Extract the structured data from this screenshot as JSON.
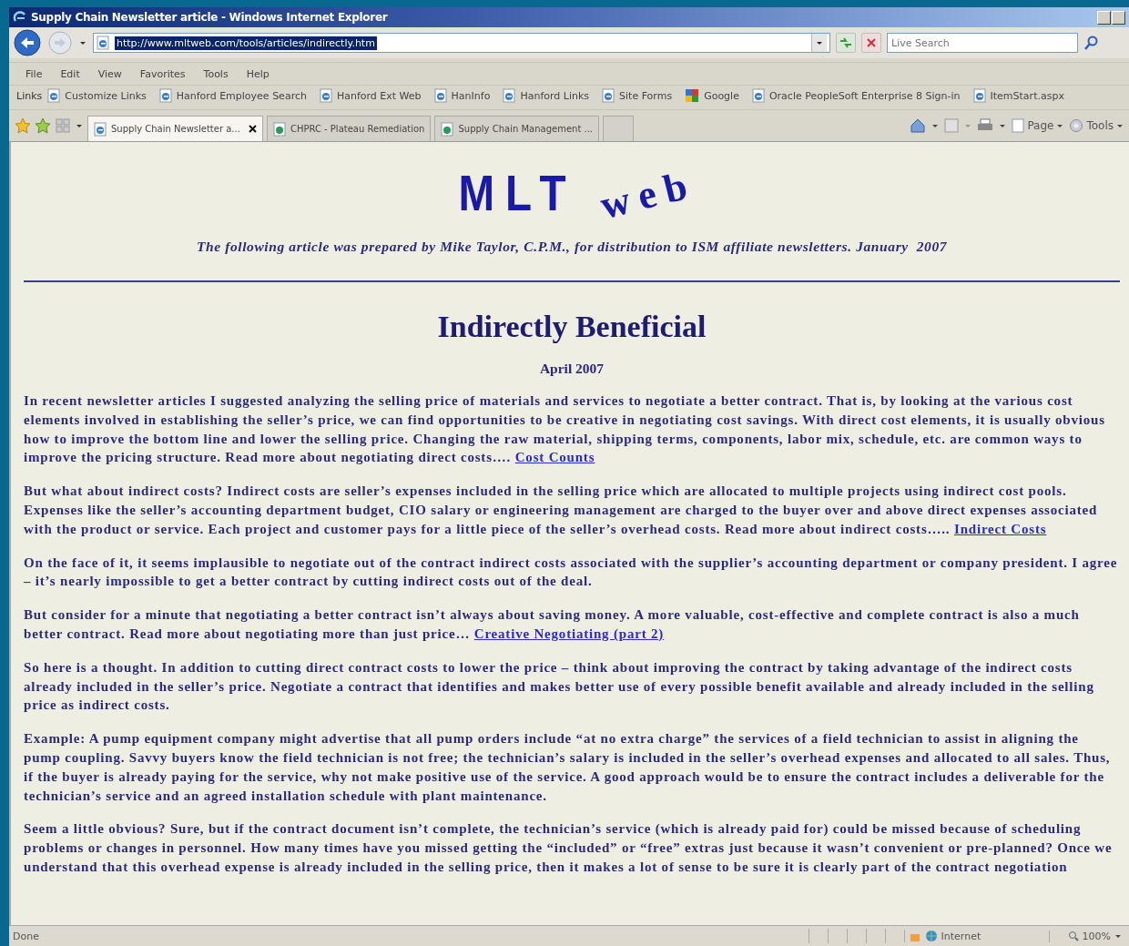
{
  "window": {
    "title": "Supply Chain Newsletter article - Windows Internet Explorer"
  },
  "address_bar": {
    "url": "http://www.mltweb.com/tools/articles/indirectly.htm",
    "url_selected": true
  },
  "search": {
    "placeholder": "Live Search"
  },
  "menu": [
    "File",
    "Edit",
    "View",
    "Favorites",
    "Tools",
    "Help"
  ],
  "links_bar": {
    "label": "Links",
    "items": [
      {
        "label": "Customize Links",
        "kind": "page"
      },
      {
        "label": "Hanford Employee Search",
        "kind": "page"
      },
      {
        "label": "Hanford Ext Web",
        "kind": "page"
      },
      {
        "label": "HanInfo",
        "kind": "page"
      },
      {
        "label": "Hanford Links",
        "kind": "page"
      },
      {
        "label": "Site Forms",
        "kind": "page"
      },
      {
        "label": "Google",
        "kind": "google"
      },
      {
        "label": "Oracle PeopleSoft Enterprise 8 Sign-in",
        "kind": "page"
      },
      {
        "label": "ItemStart.aspx",
        "kind": "page"
      }
    ]
  },
  "tabs": [
    {
      "label": "Supply Chain Newsletter a...",
      "selected": true
    },
    {
      "label": "CHPRC - Plateau Remediation",
      "selected": false
    },
    {
      "label": "Supply Chain Management ...",
      "selected": false
    }
  ],
  "command_bar": [
    "Page",
    "Tools"
  ],
  "page": {
    "logo": {
      "main": "MLT",
      "tail": "web"
    },
    "byline": "The following article was prepared by Mike Taylor, C.P.M., for distribution to ISM affiliate newsletters. January  2007",
    "title": "Indirectly Beneficial",
    "date": "April 2007",
    "paragraphs": [
      {
        "text": "In recent newsletter articles I suggested analyzing the selling price of materials and services to negotiate a better contract. That is, by looking at the various cost elements involved in establishing the seller’s price, we can find opportunities to be creative in negotiating cost savings. With direct cost elements, it is usually obvious how to improve the bottom line and lower the selling price. Changing the raw material, shipping terms, components, labor mix, schedule, etc. are common ways to improve the pricing structure. Read more about negotiating direct costs….",
        "link": "Cost Counts"
      },
      {
        "text": "But what about indirect costs? Indirect costs are seller’s expenses included in the selling price which are allocated to multiple projects using indirect cost pools. Expenses like the seller’s accounting department budget, CIO salary or engineering management are charged to the buyer over and above direct expenses associated with the product or service. Each project and customer pays for a little piece of the seller’s overhead costs. Read more about indirect costs…..",
        "link": "Indirect Costs"
      },
      {
        "text": "On the face of it, it seems implausible to negotiate out of the contract indirect costs associated with the supplier’s accounting department or company president. I agree – it’s nearly impossible to get a better contract by cutting indirect costs out of the deal."
      },
      {
        "text": "But consider for a minute that negotiating a better contract isn’t always about saving money. A more valuable, cost-effective and complete contract is also a much better contract. Read more about negotiating more than just price…",
        "link": "Creative Negotiating (part 2)"
      },
      {
        "text": "So here is a thought. In addition to cutting direct contract costs to lower the price – think about improving the contract by taking advantage of the indirect costs already included in the seller’s price. Negotiate a contract that identifies and makes better use of every possible benefit available and already included in the selling price as indirect costs."
      },
      {
        "text": "Example: A pump equipment company might advertise that all pump orders include “at no extra charge” the services of a field technician to assist in aligning the pump coupling. Savvy buyers know the field technician is not free; the technician’s salary is included in the seller’s overhead expenses and allocated to all sales. Thus, if the buyer is already paying for the service, why not make positive use of the service. A good approach would be to ensure the contract includes a deliverable for the technician’s service and an agreed installation schedule with plant maintenance."
      },
      {
        "text": "Seem a little obvious? Sure, but if the contract document isn’t complete, the technician’s service (which is already paid for) could be missed because of scheduling problems or changes in personnel. How many times have you missed getting the “included” or “free” extras just because it wasn’t convenient or pre-planned? Once we understand that this overhead expense is already included in the selling price, then it makes a lot of sense to be sure it is clearly part of the contract negotiation"
      }
    ]
  },
  "status_bar": {
    "text": "Done",
    "zone": "Internet",
    "zoom": "100%"
  }
}
